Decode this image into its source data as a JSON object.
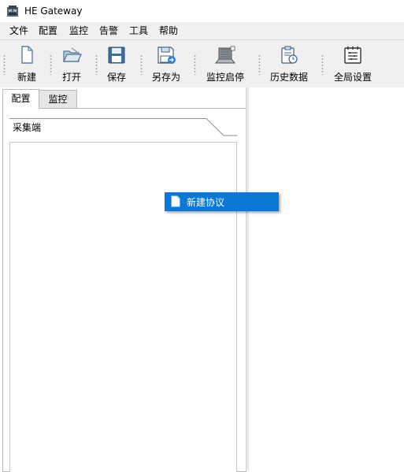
{
  "window": {
    "title": "HE Gateway"
  },
  "menu": [
    "文件",
    "配置",
    "监控",
    "告警",
    "工具",
    "帮助"
  ],
  "toolbar": {
    "new": "新建",
    "open": "打开",
    "save": "保存",
    "save_as": "另存为",
    "monitor_start_stop": "监控启停",
    "history_data": "历史数据",
    "global_settings": "全局设置"
  },
  "tabs": {
    "config": "配置",
    "monitor": "监控"
  },
  "panel": {
    "collector_label": "采集端"
  },
  "context_menu": {
    "new_protocol": "新建协议"
  },
  "colors": {
    "selection": "#0a78d7",
    "toolbar_bg": "#f0f0f0"
  }
}
